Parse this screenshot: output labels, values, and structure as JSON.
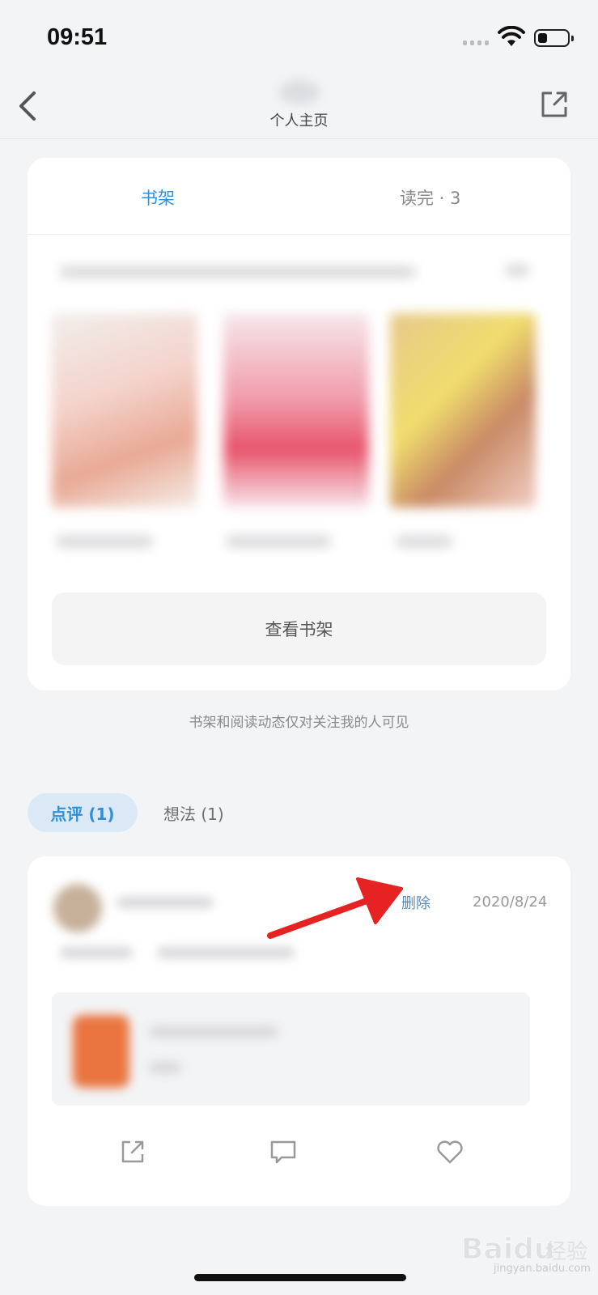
{
  "status": {
    "time": "09:51"
  },
  "nav": {
    "title": "个人主页"
  },
  "shelf": {
    "tab_shelf": "书架",
    "tab_done": "读完 · 3",
    "view_button": "查看书架"
  },
  "privacy_note": "书架和阅读动态仅对关注我的人可见",
  "review_tabs": {
    "review": "点评 (1)",
    "idea": "想法 (1)"
  },
  "review": {
    "delete_label": "删除",
    "date": "2020/8/24"
  },
  "colors": {
    "accent": "#2f8fd8",
    "background": "#f3f4f6",
    "delete_link": "#5d8ab5",
    "annotation_arrow": "#e62222"
  },
  "watermark": {
    "text": "jingyan.baidu.com"
  }
}
